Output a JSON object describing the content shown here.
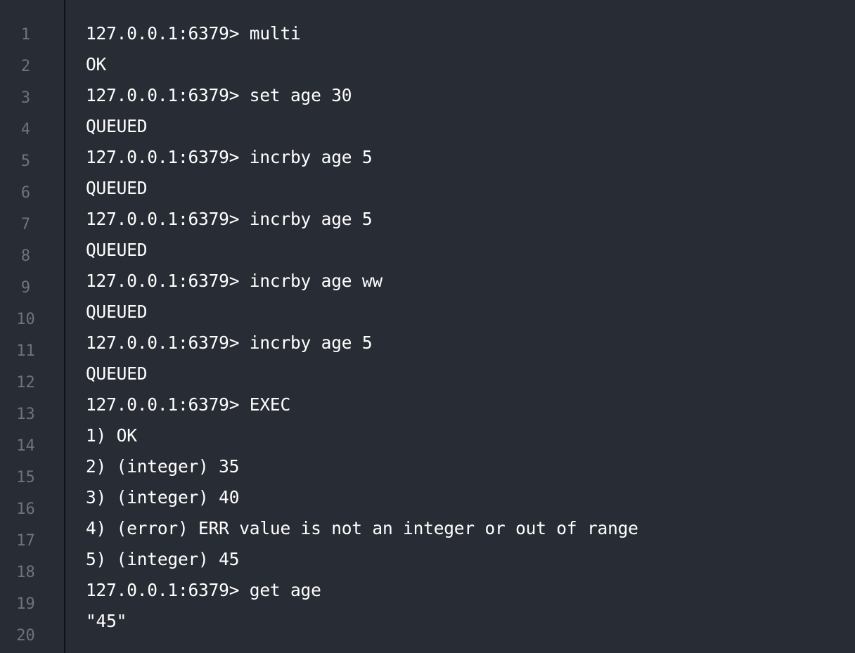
{
  "editor": {
    "line_numbers": [
      "1",
      "2",
      "3",
      "4",
      "5",
      "6",
      "7",
      "8",
      "9",
      "10",
      "11",
      "12",
      "13",
      "14",
      "15",
      "16",
      "17",
      "18",
      "19",
      "20"
    ],
    "lines": [
      "127.0.0.1:6379> multi",
      "OK",
      "127.0.0.1:6379> set age 30",
      "QUEUED",
      "127.0.0.1:6379> incrby age 5",
      "QUEUED",
      "127.0.0.1:6379> incrby age 5",
      "QUEUED",
      "127.0.0.1:6379> incrby age ww",
      "QUEUED",
      "127.0.0.1:6379> incrby age 5",
      "QUEUED",
      "127.0.0.1:6379> EXEC",
      "1) OK",
      "2) (integer) 35",
      "3) (integer) 40",
      "4) (error) ERR value is not an integer or out of range",
      "5) (integer) 45",
      "127.0.0.1:6379> get age",
      "\"45\""
    ]
  },
  "colors": {
    "background": "#282c34",
    "line_number": "#6f747c",
    "text": "#ffffff",
    "gutter_border": "#0f1115"
  }
}
